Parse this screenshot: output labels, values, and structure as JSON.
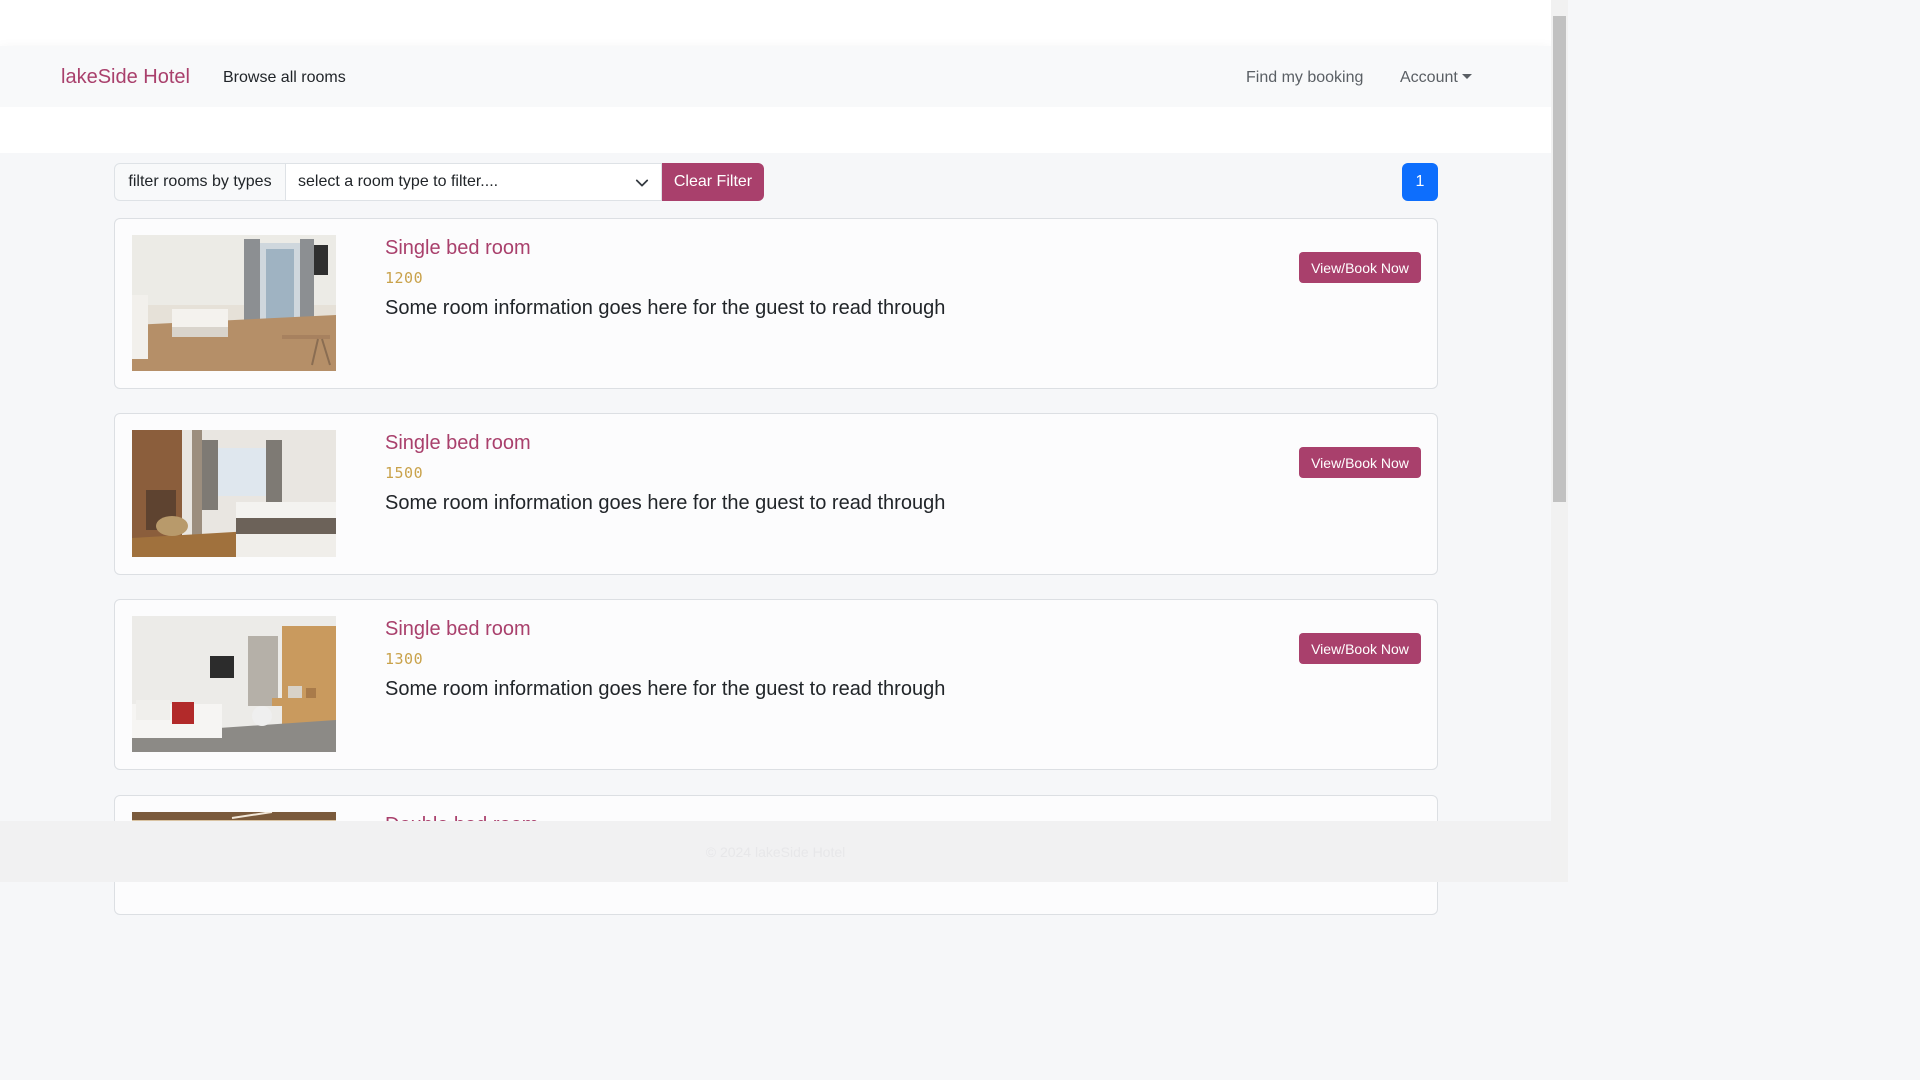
{
  "navbar": {
    "brand": "lakeSide Hotel",
    "browse_label": "Browse all rooms",
    "find_booking_label": "Find my booking",
    "account_label": "Account"
  },
  "filter": {
    "label": "filter rooms by types",
    "select_placeholder": "select a room type to filter....",
    "clear_label": "Clear Filter"
  },
  "pagination": {
    "current_page": "1"
  },
  "rooms": [
    {
      "title": "Single bed room",
      "price": "1200",
      "info": "Some room information goes here for the guest to read through",
      "button": "View/Book Now"
    },
    {
      "title": "Single bed room",
      "price": "1500",
      "info": "Some room information goes here for the guest to read through",
      "button": "View/Book Now"
    },
    {
      "title": "Single bed room",
      "price": "1300",
      "info": "Some room information goes here for the guest to read through",
      "button": "View/Book Now"
    },
    {
      "title": "Double bed room",
      "price": "",
      "info": "",
      "button": ""
    }
  ],
  "footer": {
    "text": "© 2024 lakeSide Hotel"
  },
  "colors": {
    "accent": "#a9406c",
    "price": "#c9a24b",
    "page_active": "#0d6efd"
  }
}
